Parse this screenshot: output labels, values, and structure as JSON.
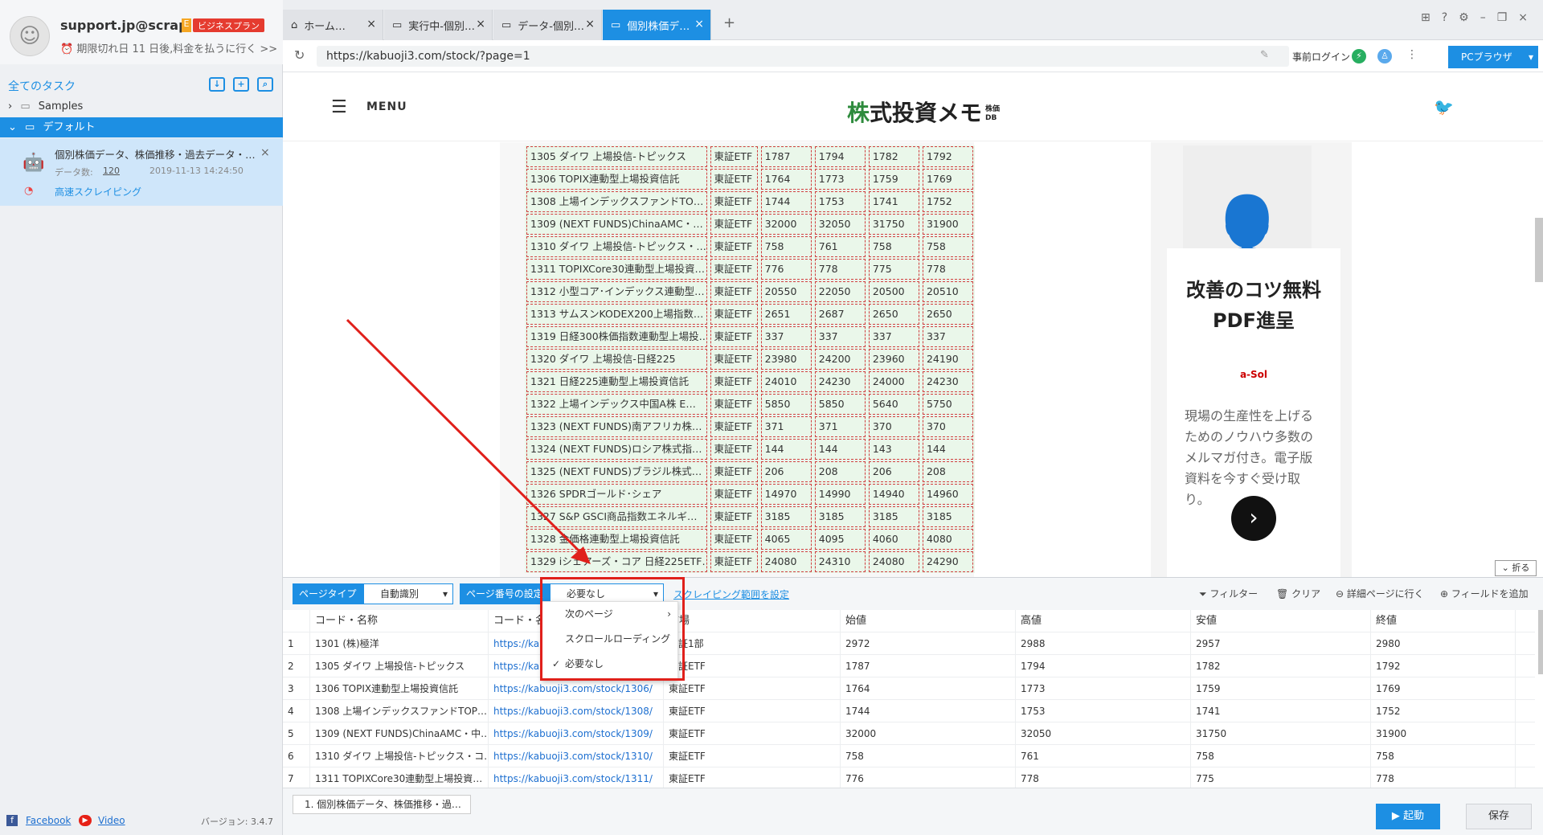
{
  "account": {
    "email": "support.jp@scrap…",
    "plan_short": "E",
    "plan": "ビジネスプラン",
    "expire": "期限切れ日 11 日後,料金を払うに行く >>"
  },
  "sidebar": {
    "all_tasks": "全てのタスク",
    "folders": [
      {
        "label": "Samples"
      },
      {
        "label": "デフォルト"
      }
    ],
    "task": {
      "title": "個別株価データ、株価推移・過去データ・…",
      "count_label": "データ数:",
      "count": "120",
      "date": "2019-11-13 14:24:50",
      "mode": "高速スクレイピング"
    },
    "footer": {
      "facebook": "Facebook",
      "video": "Video",
      "version": "バージョン: 3.4.7"
    }
  },
  "tabs": [
    {
      "label": "ホーム…"
    },
    {
      "label": "実行中-個別…"
    },
    {
      "label": "データ-個別…"
    },
    {
      "label": "個別株価デ…"
    }
  ],
  "addressbar": {
    "url": "https://kabuoji3.com/stock/?page=1",
    "prelogin": "事前ログイン",
    "browser": "PCブラウザ"
  },
  "site": {
    "menu": "MENU",
    "logo_green": "株",
    "logo_rest": "式投資メモ",
    "logo_badge": "株価DB",
    "ad": {
      "headline1": "改善のコツ無料",
      "headline2": "PDF進呈",
      "brand": "a-Sol",
      "body": "現場の生産性を上げるためのノウハウ多数のメルマガ付き。電子版資料を今すぐ受け取り。"
    },
    "fold": "折る",
    "stocks": [
      [
        "1305 ダイワ 上場投信-トピックス",
        "東証ETF",
        "1787",
        "1794",
        "1782",
        "1792"
      ],
      [
        "1306 TOPIX連動型上場投資信託",
        "東証ETF",
        "1764",
        "1773",
        "1759",
        "1769"
      ],
      [
        "1308 上場インデックスファンドTO…",
        "東証ETF",
        "1744",
        "1753",
        "1741",
        "1752"
      ],
      [
        "1309 (NEXT FUNDS)ChinaAMC・…",
        "東証ETF",
        "32000",
        "32050",
        "31750",
        "31900"
      ],
      [
        "1310 ダイワ 上場投信-トピックス・…",
        "東証ETF",
        "758",
        "761",
        "758",
        "758"
      ],
      [
        "1311 TOPIXCore30連動型上場投資…",
        "東証ETF",
        "776",
        "778",
        "775",
        "778"
      ],
      [
        "1312 小型コア･インデックス連動型…",
        "東証ETF",
        "20550",
        "22050",
        "20500",
        "20510"
      ],
      [
        "1313 サムスンKODEX200上場指数…",
        "東証ETF",
        "2651",
        "2687",
        "2650",
        "2650"
      ],
      [
        "1319 日経300株価指数連動型上場投…",
        "東証ETF",
        "337",
        "337",
        "337",
        "337"
      ],
      [
        "1320 ダイワ 上場投信-日経225",
        "東証ETF",
        "23980",
        "24200",
        "23960",
        "24190"
      ],
      [
        "1321 日経225連動型上場投資信託",
        "東証ETF",
        "24010",
        "24230",
        "24000",
        "24230"
      ],
      [
        "1322 上場インデックス中国A株 E…",
        "東証ETF",
        "5850",
        "5850",
        "5640",
        "5750"
      ],
      [
        "1323 (NEXT FUNDS)南アフリカ株…",
        "東証ETF",
        "371",
        "371",
        "370",
        "370"
      ],
      [
        "1324 (NEXT FUNDS)ロシア株式指…",
        "東証ETF",
        "144",
        "144",
        "143",
        "144"
      ],
      [
        "1325 (NEXT FUNDS)ブラジル株式…",
        "東証ETF",
        "206",
        "208",
        "206",
        "208"
      ],
      [
        "1326 SPDRゴールド･シェア",
        "東証ETF",
        "14970",
        "14990",
        "14940",
        "14960"
      ],
      [
        "1327 S&P GSCI商品指数エネルギ…",
        "東証ETF",
        "3185",
        "3185",
        "3185",
        "3185"
      ],
      [
        "1328 金価格連動型上場投資信託",
        "東証ETF",
        "4065",
        "4095",
        "4060",
        "4080"
      ],
      [
        "1329 iシェアーズ・コア 日経225ETF…",
        "東証ETF",
        "24080",
        "24310",
        "24080",
        "24290"
      ]
    ]
  },
  "panel": {
    "page_type_label": "ページタイプ",
    "page_type_value": "自動識別",
    "page_num_label": "ページ番号の設定",
    "page_num_value": "必要なし",
    "scrape_range": "スクレイピング範囲を設定",
    "filter": "フィルター",
    "clear": "クリア",
    "detail": "詳細ページに行く",
    "add_field": "フィールドを追加",
    "dropdown": [
      "次のページ",
      "スクロールローディング",
      "必要なし"
    ],
    "columns": [
      "",
      "コード・名称",
      "コード・名称",
      "市場",
      "始値",
      "高値",
      "安値",
      "終値"
    ],
    "rows": [
      [
        "1",
        "1301 (株)極洋",
        "https://kabuoji3.com/stock/1301/",
        "東証1部",
        "2972",
        "2988",
        "2957",
        "2980"
      ],
      [
        "2",
        "1305 ダイワ 上場投信-トピックス",
        "https://kabuoji3.com/stock/1305/",
        "東証ETF",
        "1787",
        "1794",
        "1782",
        "1792"
      ],
      [
        "3",
        "1306 TOPIX連動型上場投資信託",
        "https://kabuoji3.com/stock/1306/",
        "東証ETF",
        "1764",
        "1773",
        "1759",
        "1769"
      ],
      [
        "4",
        "1308 上場インデックスファンドTOP…",
        "https://kabuoji3.com/stock/1308/",
        "東証ETF",
        "1744",
        "1753",
        "1741",
        "1752"
      ],
      [
        "5",
        "1309 (NEXT FUNDS)ChinaAMC・中…",
        "https://kabuoji3.com/stock/1309/",
        "東証ETF",
        "32000",
        "32050",
        "31750",
        "31900"
      ],
      [
        "6",
        "1310 ダイワ 上場投信-トピックス・コ…",
        "https://kabuoji3.com/stock/1310/",
        "東証ETF",
        "758",
        "761",
        "758",
        "758"
      ],
      [
        "7",
        "1311 TOPIXCore30連動型上場投資…",
        "https://kabuoji3.com/stock/1311/",
        "東証ETF",
        "776",
        "778",
        "775",
        "778"
      ]
    ],
    "task_tab": "1. 個別株価データ、株価推移・過…",
    "start": "▶ 起動",
    "save": "保存"
  },
  "colors": {
    "accent": "#1d8fe3",
    "highlight_red": "#e0201b"
  }
}
